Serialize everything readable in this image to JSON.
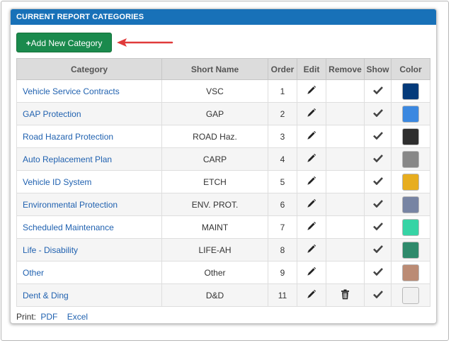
{
  "panel": {
    "title": "CURRENT REPORT CATEGORIES",
    "add_button_label": "Add New Category",
    "add_button_plus": "+"
  },
  "table": {
    "headers": {
      "category": "Category",
      "short_name": "Short Name",
      "order": "Order",
      "edit": "Edit",
      "remove": "Remove",
      "show": "Show",
      "color": "Color"
    },
    "rows": [
      {
        "category": "Vehicle Service Contracts",
        "short_name": "VSC",
        "order": "1",
        "removable": false,
        "shown": true,
        "color": "#043a7a"
      },
      {
        "category": "GAP Protection",
        "short_name": "GAP",
        "order": "2",
        "removable": false,
        "shown": true,
        "color": "#3b88e0"
      },
      {
        "category": "Road Hazard Protection",
        "short_name": "ROAD Haz.",
        "order": "3",
        "removable": false,
        "shown": true,
        "color": "#2e2e2e"
      },
      {
        "category": "Auto Replacement Plan",
        "short_name": "CARP",
        "order": "4",
        "removable": false,
        "shown": true,
        "color": "#878787"
      },
      {
        "category": "Vehicle ID System",
        "short_name": "ETCH",
        "order": "5",
        "removable": false,
        "shown": true,
        "color": "#e7ad1f"
      },
      {
        "category": "Environmental Protection",
        "short_name": "ENV. PROT.",
        "order": "6",
        "removable": false,
        "shown": true,
        "color": "#7784a3"
      },
      {
        "category": "Scheduled Maintenance",
        "short_name": "MAINT",
        "order": "7",
        "removable": false,
        "shown": true,
        "color": "#36d4a5"
      },
      {
        "category": "Life - Disability",
        "short_name": "LIFE-AH",
        "order": "8",
        "removable": false,
        "shown": true,
        "color": "#2e8a6b"
      },
      {
        "category": "Other",
        "short_name": "Other",
        "order": "9",
        "removable": false,
        "shown": true,
        "color": "#bb8b74"
      },
      {
        "category": "Dent & Ding",
        "short_name": "D&D",
        "order": "11",
        "removable": true,
        "shown": true,
        "color": "#f0f0f0"
      }
    ]
  },
  "footer": {
    "print_label": "Print:",
    "pdf_label": "PDF",
    "excel_label": "Excel"
  },
  "colors": {
    "header_blue": "#1871b8",
    "button_green": "#1a8a4d",
    "link_blue": "#2162b0",
    "arrow_red": "#e03a3a"
  },
  "icons": {
    "edit": "pencil-icon",
    "remove": "trash-icon",
    "show": "checkmark-icon",
    "add": "plus-icon",
    "annotation": "red-arrow"
  }
}
